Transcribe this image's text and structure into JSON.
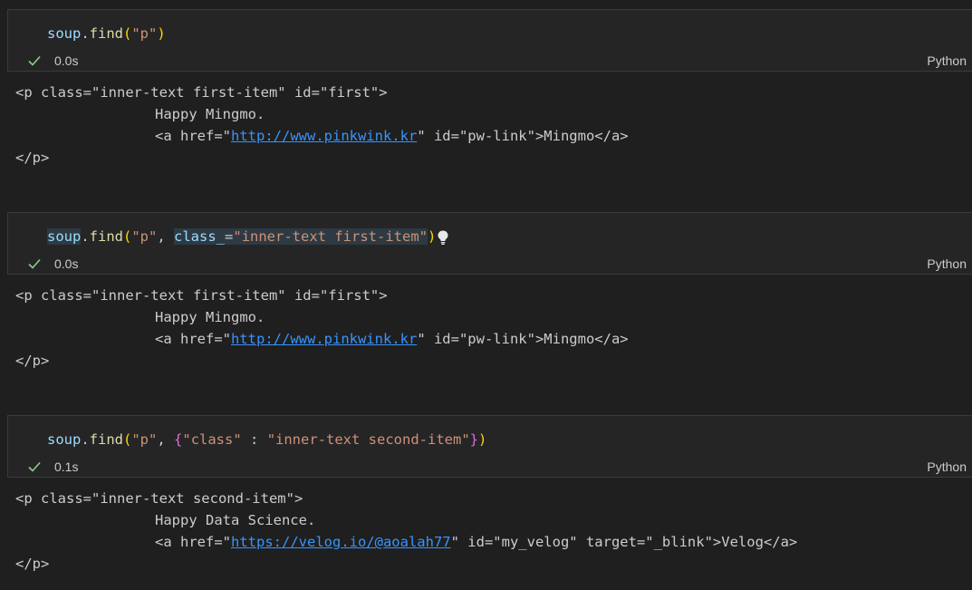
{
  "cells": [
    {
      "code": {
        "var": "soup",
        "dot": ".",
        "func": "find",
        "open": "(",
        "arg1": "\"p\"",
        "close": ")"
      },
      "status": {
        "time": "0.0s"
      },
      "language": "Python",
      "output": {
        "line1": "<p class=\"inner-text first-item\" id=\"first\">",
        "line2": "Happy Mingmo.",
        "line3_pre": "<a href=\"",
        "line3_link": "http://www.pinkwink.kr",
        "line3_post": "\" id=\"pw-link\">Mingmo</a>",
        "line4": "</p>"
      }
    },
    {
      "code": {
        "var": "soup",
        "dot": ".",
        "func": "find",
        "open": "(",
        "arg1": "\"p\"",
        "comma": ", ",
        "kw": "class_",
        "eq": "=",
        "arg2": "\"inner-text first-item\"",
        "close": ")"
      },
      "status": {
        "time": "0.0s"
      },
      "language": "Python",
      "output": {
        "line1": "<p class=\"inner-text first-item\" id=\"first\">",
        "line2": "Happy Mingmo.",
        "line3_pre": "<a href=\"",
        "line3_link": "http://www.pinkwink.kr",
        "line3_post": "\" id=\"pw-link\">Mingmo</a>",
        "line4": "</p>"
      }
    },
    {
      "code": {
        "var": "soup",
        "dot": ".",
        "func": "find",
        "open": "(",
        "arg1": "\"p\"",
        "comma": ", ",
        "brace_open": "{",
        "key": "\"class\"",
        "colon": " : ",
        "val": "\"inner-text second-item\"",
        "brace_close": "}",
        "close": ")"
      },
      "status": {
        "time": "0.1s"
      },
      "language": "Python",
      "output": {
        "line1": "<p class=\"inner-text second-item\">",
        "line2": "Happy Data Science.",
        "line3_pre": "<a href=\"",
        "line3_link": "https://velog.io/@aoalah77",
        "line3_post": "\" id=\"my_velog\" target=\"_blink\">Velog</a>",
        "line4": "</p>"
      }
    }
  ],
  "icons": {
    "status": "check-icon",
    "hint": "lightbulb-icon"
  },
  "colors": {
    "success": "#89d185",
    "link": "#3794ff",
    "string": "#ce9178"
  }
}
